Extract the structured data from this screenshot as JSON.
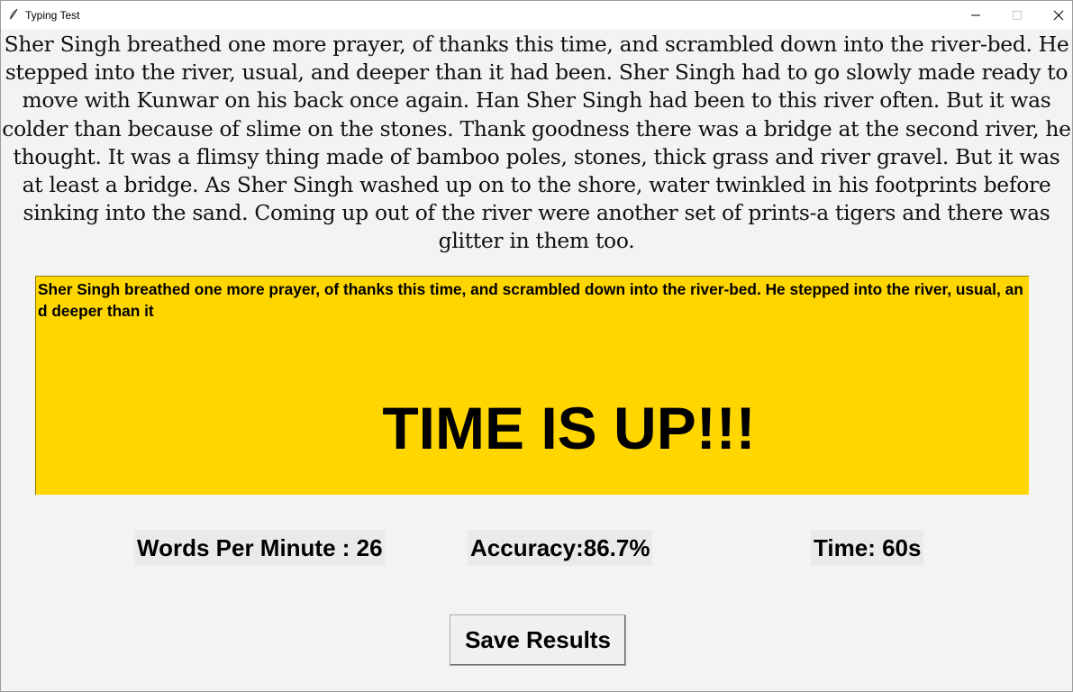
{
  "window": {
    "title": "Typing Test",
    "icons": {
      "app": "feather-icon",
      "minimize": "minimize-icon",
      "maximize": "maximize-icon",
      "close": "close-icon"
    }
  },
  "passage": {
    "text": "Sher Singh breathed one more prayer, of thanks this time, and scrambled down into the river-bed. He stepped into the river, usual, and deeper than it had been. Sher Singh had to go slowly made ready to move with Kunwar on his back once again. Han Sher Singh had been to this river often. But it was colder than because of slime on the stones. Thank goodness there was a bridge at the second river, he thought. It was a flimsy thing made of bamboo poles, stones, thick grass and river gravel. But it was at least a bridge. As Sher Singh washed up on to the shore, water twinkled in his footprints before sinking into the sand. Coming up out of the river were another set of prints-a tigers and there was glitter in them too."
  },
  "typing_area": {
    "typed_text": "Sher Singh breathed one more prayer, of thanks this time, and scrambled down into the river-bed. He stepped into the river, usual, and deeper than it",
    "message": "TIME IS UP!!!",
    "background": "#ffd600"
  },
  "results": {
    "wpm_label": "Words Per Minute : 26",
    "accuracy_label": "Accuracy:86.7%",
    "time_label": "Time: 60s"
  },
  "actions": {
    "save_label": "Save Results"
  }
}
